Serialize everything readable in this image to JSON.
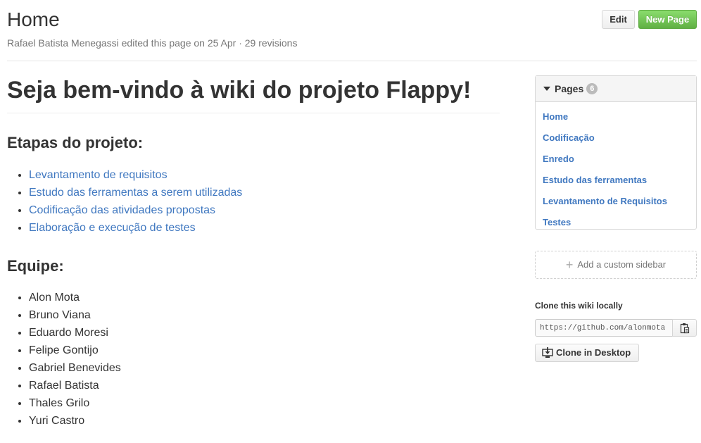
{
  "header": {
    "title": "Home",
    "meta": "Rafael Batista Menegassi edited this page on 25 Apr · 29 revisions",
    "edit_label": "Edit",
    "new_page_label": "New Page"
  },
  "content": {
    "heading": "Seja bem-vindo à wiki do projeto Flappy!",
    "steps_heading": "Etapas do projeto:",
    "steps": [
      "Levantamento de requisitos",
      "Estudo das ferramentas a serem utilizadas",
      "Codificação das atividades propostas",
      "Elaboração e execução de testes"
    ],
    "team_heading": "Equipe:",
    "team": [
      "Alon Mota",
      "Bruno Viana",
      "Eduardo Moresi",
      "Felipe Gontijo",
      "Gabriel Benevides",
      "Rafael Batista",
      "Thales Grilo",
      "Yuri Castro"
    ]
  },
  "sidebar": {
    "pages_label": "Pages",
    "pages_count": "6",
    "pages": [
      "Home",
      "Codificação",
      "Enredo",
      "Estudo das ferramentas",
      "Levantamento de Requisitos",
      "Testes"
    ],
    "add_custom_sidebar": "Add a custom sidebar",
    "clone_label": "Clone this wiki locally",
    "clone_url": "https://github.com/alonmota",
    "clone_desktop_label": "Clone in Desktop"
  },
  "colors": {
    "link": "#4078c0",
    "new_page_button": "#6cc644",
    "counter_badge": "#bbbbbb"
  }
}
